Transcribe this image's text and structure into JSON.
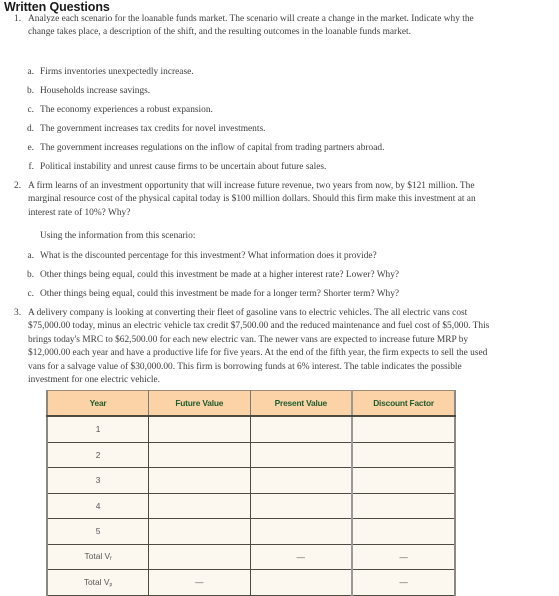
{
  "heading": "Written Questions",
  "questions": [
    {
      "number": "1.",
      "text": "Analyze each scenario for the loanable funds market. The scenario will create a change in the market. Indicate why the change takes place, a description of the shift, and the resulting outcomes in the loanable funds market.",
      "items": [
        {
          "letter": "a.",
          "text": "Firms inventories unexpectedly increase."
        },
        {
          "letter": "b.",
          "text": "Households increase savings."
        },
        {
          "letter": "c.",
          "text": "The economy experiences a robust expansion."
        },
        {
          "letter": "d.",
          "text": "The government increases tax credits for novel investments."
        },
        {
          "letter": "e.",
          "text": "The government increases regulations on the inflow of capital from trading partners abroad."
        },
        {
          "letter": "f.",
          "text": "Political instability and unrest cause firms to be uncertain about future sales."
        }
      ]
    },
    {
      "number": "2.",
      "text": "A firm learns of an investment opportunity that will increase future revenue, two years from now, by $121 million. The marginal resource cost of the physical capital today is $100 million dollars. Should this firm make this investment at an interest rate of 10%? Why?",
      "intro": "Using the information from this scenario:",
      "items": [
        {
          "letter": "a.",
          "text": "What is the discounted percentage for this investment? What information does it provide?"
        },
        {
          "letter": "b.",
          "text": "Other things being equal, could this investment be made at a higher interest rate? Lower? Why?"
        },
        {
          "letter": "c.",
          "text": "Other things being equal, could this investment be made for a longer term? Shorter term? Why?"
        }
      ]
    },
    {
      "number": "3.",
      "text": "A delivery company is looking at converting their fleet of gasoline vans to electric vehicles. The all electric vans cost $75,000.00 today, minus an electric vehicle tax credit $7,500.00 and the reduced maintenance and fuel cost of $5,000. This brings today's MRC to $62,500.00 for each new electric van. The newer vans are expected to increase future MRP by $12,000.00 each year and have a productive life for five years. At the end of the fifth year, the firm expects to sell the used vans for a salvage value of $30,000.00. This firm is borrowing funds at 6% interest. The table indicates the possible investment for one electric vehicle."
    }
  ],
  "table": {
    "headers": [
      "Year",
      "Future Value",
      "Present Value",
      "Discount Factor"
    ],
    "rows": [
      [
        "1",
        "",
        "",
        ""
      ],
      [
        "2",
        "",
        "",
        ""
      ],
      [
        "3",
        "",
        "",
        ""
      ],
      [
        "4",
        "",
        "",
        ""
      ],
      [
        "5",
        "",
        "",
        ""
      ]
    ],
    "total_f": {
      "label": "Total V",
      "subscript": "f",
      "cells": [
        "",
        "—",
        "—"
      ]
    },
    "total_p": {
      "label": "Total V",
      "subscript": "p",
      "cells": [
        "—",
        "",
        "—"
      ]
    },
    "colors": {
      "header_bg": "#fcd3a7",
      "header_text": "#1f5c2e",
      "cell_bg": "#fdf8ef"
    }
  }
}
